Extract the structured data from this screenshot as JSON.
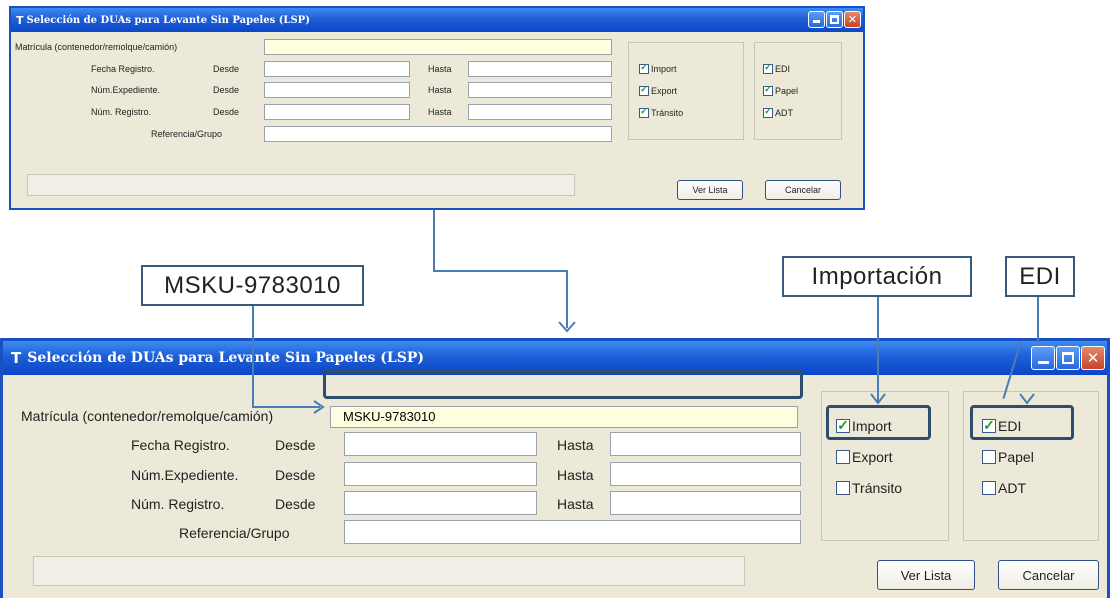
{
  "window": {
    "title": "Selección de DUAs para Levante Sin Papeles (LSP)",
    "close_glyph": "✕",
    "app_icon": "T"
  },
  "form": {
    "matricula_label": "Matrícula (contenedor/remolque/camión)",
    "fecha_label": "Fecha Registro.",
    "expediente_label": "Núm.Expediente.",
    "registro_label": "Núm. Registro.",
    "referencia_label": "Referencia/Grupo",
    "desde_label": "Desde",
    "hasta_label": "Hasta"
  },
  "filters": {
    "import_label": "Import",
    "export_label": "Export",
    "transito_label": "Tránsito",
    "edi_label": "EDI",
    "papel_label": "Papel",
    "adt_label": "ADT"
  },
  "buttons": {
    "ver_lista": "Ver Lista",
    "cancelar": "Cancelar"
  },
  "top_state": {
    "matricula": "",
    "import": true,
    "export": true,
    "transito": true,
    "edi": true,
    "papel": true,
    "adt": true
  },
  "bottom_state": {
    "matricula": "MSKU-9783010",
    "import": true,
    "export": false,
    "transito": false,
    "edi": true,
    "papel": false,
    "adt": false
  },
  "callouts": {
    "matricula": "MSKU-9783010",
    "importacion": "Importación",
    "edi": "EDI"
  },
  "colors": {
    "titlebar": "#1f5fd6",
    "window_bg": "#ece9d8",
    "highlight_field": "#ffffe0",
    "callout_border": "#3a5a7c",
    "arrow": "#4a7db5"
  }
}
